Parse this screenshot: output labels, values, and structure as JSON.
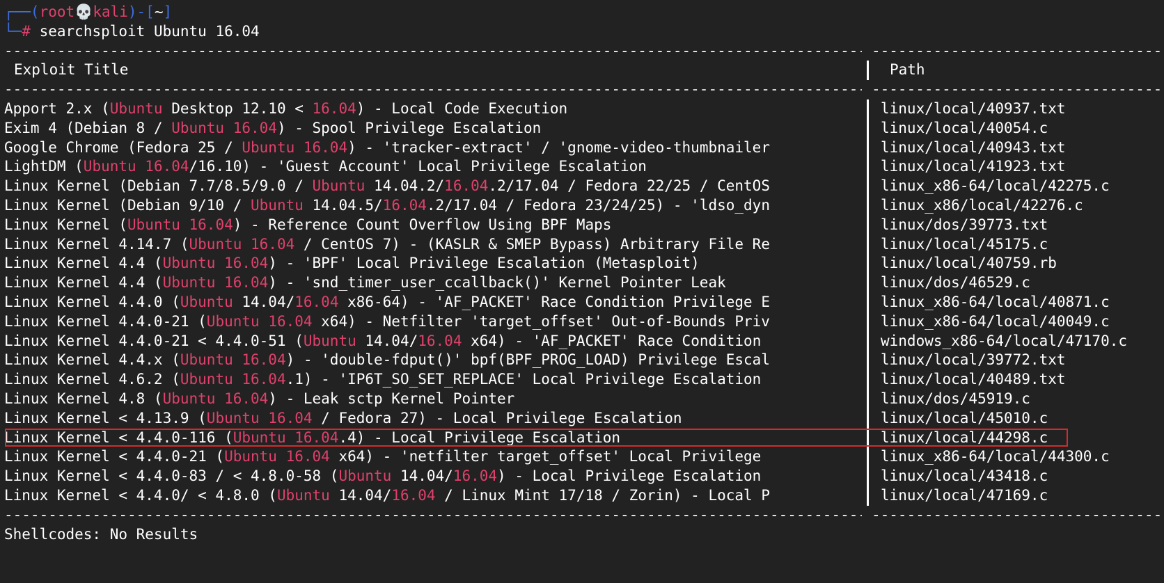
{
  "prompt": {
    "corner_top": "┌──(",
    "user": "root",
    "skull": "💀",
    "host": "kali",
    "mid": ")-[",
    "dir": "~",
    "end": "]",
    "corner_bottom": "└─",
    "hash": "#",
    "command": "searchsploit Ubuntu 16.04"
  },
  "header": {
    "title": "Exploit Title",
    "sep": "|",
    "path": "Path"
  },
  "rows": [
    {
      "parts": [
        [
          "w",
          "Apport 2.x ("
        ],
        [
          "r",
          "Ubuntu"
        ],
        [
          "w",
          " Desktop 12.10 < "
        ],
        [
          "r",
          "16.04"
        ],
        [
          "w",
          ") - Local Code Execution"
        ]
      ],
      "path": "linux/local/40937.txt"
    },
    {
      "parts": [
        [
          "w",
          "Exim 4 (Debian 8 / "
        ],
        [
          "r",
          "Ubuntu 16.04"
        ],
        [
          "w",
          ") - Spool Privilege Escalation"
        ]
      ],
      "path": "linux/local/40054.c"
    },
    {
      "parts": [
        [
          "w",
          "Google Chrome (Fedora 25 / "
        ],
        [
          "r",
          "Ubuntu 16.04"
        ],
        [
          "w",
          ") - 'tracker-extract' / 'gnome-video-thumbnailer"
        ]
      ],
      "path": "linux/local/40943.txt"
    },
    {
      "parts": [
        [
          "w",
          "LightDM ("
        ],
        [
          "r",
          "Ubuntu 16.04"
        ],
        [
          "w",
          "/16.10) - 'Guest Account' Local Privilege Escalation"
        ]
      ],
      "path": "linux/local/41923.txt"
    },
    {
      "parts": [
        [
          "w",
          "Linux Kernel (Debian 7.7/8.5/9.0 / "
        ],
        [
          "r",
          "Ubuntu"
        ],
        [
          "w",
          " 14.04.2/"
        ],
        [
          "r",
          "16.04"
        ],
        [
          "w",
          ".2/17.04 / Fedora 22/25 / CentOS"
        ]
      ],
      "path": "linux_x86-64/local/42275.c"
    },
    {
      "parts": [
        [
          "w",
          "Linux Kernel (Debian 9/10 / "
        ],
        [
          "r",
          "Ubuntu"
        ],
        [
          "w",
          " 14.04.5/"
        ],
        [
          "r",
          "16.04"
        ],
        [
          "w",
          ".2/17.04 / Fedora 23/24/25) - 'ldso_dyn"
        ]
      ],
      "path": "linux_x86/local/42276.c"
    },
    {
      "parts": [
        [
          "w",
          "Linux Kernel ("
        ],
        [
          "r",
          "Ubuntu 16.04"
        ],
        [
          "w",
          ") - Reference Count Overflow Using BPF Maps"
        ]
      ],
      "path": "linux/dos/39773.txt"
    },
    {
      "parts": [
        [
          "w",
          "Linux Kernel 4.14.7 ("
        ],
        [
          "r",
          "Ubuntu 16.04"
        ],
        [
          "w",
          " / CentOS 7) - (KASLR & SMEP Bypass) Arbitrary File Re"
        ]
      ],
      "path": "linux/local/45175.c"
    },
    {
      "parts": [
        [
          "w",
          "Linux Kernel 4.4 ("
        ],
        [
          "r",
          "Ubuntu 16.04"
        ],
        [
          "w",
          ") - 'BPF' Local Privilege Escalation (Metasploit)"
        ]
      ],
      "path": "linux/local/40759.rb"
    },
    {
      "parts": [
        [
          "w",
          "Linux Kernel 4.4 ("
        ],
        [
          "r",
          "Ubuntu 16.04"
        ],
        [
          "w",
          ") - 'snd_timer_user_ccallback()' Kernel Pointer Leak"
        ]
      ],
      "path": "linux/dos/46529.c"
    },
    {
      "parts": [
        [
          "w",
          "Linux Kernel 4.4.0 ("
        ],
        [
          "r",
          "Ubuntu"
        ],
        [
          "w",
          " 14.04/"
        ],
        [
          "r",
          "16.04"
        ],
        [
          "w",
          " x86-64) - 'AF_PACKET' Race Condition Privilege E"
        ]
      ],
      "path": "linux_x86-64/local/40871.c"
    },
    {
      "parts": [
        [
          "w",
          "Linux Kernel 4.4.0-21 ("
        ],
        [
          "r",
          "Ubuntu 16.04"
        ],
        [
          "w",
          " x64) - Netfilter 'target_offset' Out-of-Bounds Priv"
        ]
      ],
      "path": "linux_x86-64/local/40049.c"
    },
    {
      "parts": [
        [
          "w",
          "Linux Kernel 4.4.0-21 < 4.4.0-51 ("
        ],
        [
          "r",
          "Ubuntu"
        ],
        [
          "w",
          " 14.04/"
        ],
        [
          "r",
          "16.04"
        ],
        [
          "w",
          " x64) - 'AF_PACKET' Race Condition"
        ]
      ],
      "path": "windows_x86-64/local/47170.c"
    },
    {
      "parts": [
        [
          "w",
          "Linux Kernel 4.4.x ("
        ],
        [
          "r",
          "Ubuntu 16.04"
        ],
        [
          "w",
          ") - 'double-fdput()' bpf(BPF_PROG_LOAD) Privilege Escal"
        ]
      ],
      "path": "linux/local/39772.txt"
    },
    {
      "parts": [
        [
          "w",
          "Linux Kernel 4.6.2 ("
        ],
        [
          "r",
          "Ubuntu 16.04"
        ],
        [
          "w",
          ".1) - 'IP6T_SO_SET_REPLACE' Local Privilege Escalation"
        ]
      ],
      "path": "linux/local/40489.txt"
    },
    {
      "parts": [
        [
          "w",
          "Linux Kernel 4.8 ("
        ],
        [
          "r",
          "Ubuntu 16.04"
        ],
        [
          "w",
          ") - Leak sctp Kernel Pointer"
        ]
      ],
      "path": "linux/dos/45919.c"
    },
    {
      "parts": [
        [
          "w",
          "Linux Kernel < 4.13.9 ("
        ],
        [
          "r",
          "Ubuntu 16.04"
        ],
        [
          "w",
          " / Fedora 27) - Local Privilege Escalation"
        ]
      ],
      "path": "linux/local/45010.c"
    },
    {
      "parts": [
        [
          "w",
          "Linux Kernel < 4.4.0-116 ("
        ],
        [
          "r",
          "Ubuntu 16.04"
        ],
        [
          "w",
          ".4) - Local Privilege Escalation"
        ]
      ],
      "path": "linux/local/44298.c",
      "highlight": true
    },
    {
      "parts": [
        [
          "w",
          "Linux Kernel < 4.4.0-21 ("
        ],
        [
          "r",
          "Ubuntu 16.04"
        ],
        [
          "w",
          " x64) - 'netfilter target_offset' Local Privilege"
        ]
      ],
      "path": "linux_x86-64/local/44300.c"
    },
    {
      "parts": [
        [
          "w",
          "Linux Kernel < 4.4.0-83 / < 4.8.0-58 ("
        ],
        [
          "r",
          "Ubuntu"
        ],
        [
          "w",
          " 14.04/"
        ],
        [
          "r",
          "16.04"
        ],
        [
          "w",
          ") - Local Privilege Escalation"
        ]
      ],
      "path": "linux/local/43418.c"
    },
    {
      "parts": [
        [
          "w",
          "Linux Kernel < 4.4.0/ < 4.8.0 ("
        ],
        [
          "r",
          "Ubuntu"
        ],
        [
          "w",
          " 14.04/"
        ],
        [
          "r",
          "16.04"
        ],
        [
          "w",
          " / Linux Mint 17/18 / Zorin) - Local P"
        ]
      ],
      "path": "linux/local/47169.c"
    }
  ],
  "footer": {
    "shellcodes": "Shellcodes: No Results"
  },
  "colors": {
    "background": "#222222",
    "text": "#ffffff",
    "prompt_blue": "#3d6fe0",
    "highlight_red": "#e0416b",
    "box_border": "#d42b2b"
  }
}
